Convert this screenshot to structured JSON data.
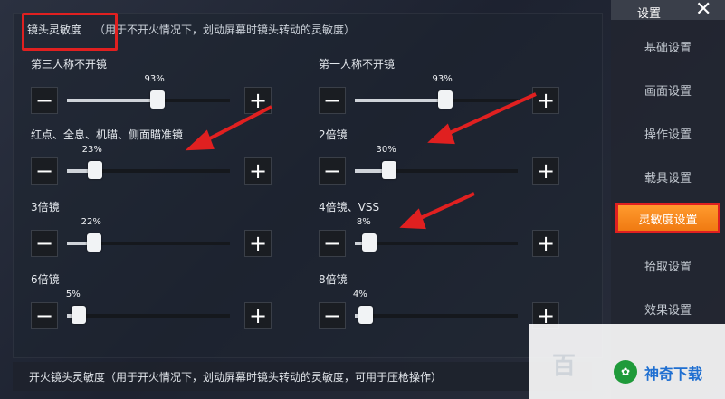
{
  "header": {
    "title": "镜头灵敏度",
    "note": "（用于不开火情况下，划动屏幕时镜头转动的灵敏度）"
  },
  "sliders": [
    {
      "label": "第三人称不开镜",
      "value": "93%",
      "level": 0.93
    },
    {
      "label": "第一人称不开镜",
      "value": "93%",
      "level": 0.93
    },
    {
      "label": "红点、全息、机瞄、侧面瞄准镜",
      "value": "23%",
      "level": 0.23
    },
    {
      "label": "2倍镜",
      "value": "30%",
      "level": 0.3
    },
    {
      "label": "3倍镜",
      "value": "22%",
      "level": 0.22
    },
    {
      "label": "4倍镜、VSS",
      "value": "8%",
      "level": 0.08
    },
    {
      "label": "6倍镜",
      "value": "5%",
      "level": 0.05
    },
    {
      "label": "8倍镜",
      "value": "4%",
      "level": 0.04
    }
  ],
  "buttons": {
    "minus": "−",
    "plus": "+"
  },
  "sidebar": {
    "title": "设置",
    "close": "✕",
    "items": [
      {
        "label": "基础设置"
      },
      {
        "label": "画面设置"
      },
      {
        "label": "操作设置"
      },
      {
        "label": "载具设置"
      },
      {
        "label": "灵敏度设置"
      },
      {
        "label": "拾取设置"
      },
      {
        "label": "效果设置"
      }
    ]
  },
  "bottom": {
    "text": "开火镜头灵敏度（用于开火情况下，划动屏幕时镜头转动的灵敏度，可用于压枪操作）"
  },
  "watermark": {
    "brand": "百",
    "logo": "✿",
    "site": "神奇下载"
  },
  "colors": {
    "accent": "#f07a12",
    "highlight": "#e02020"
  }
}
